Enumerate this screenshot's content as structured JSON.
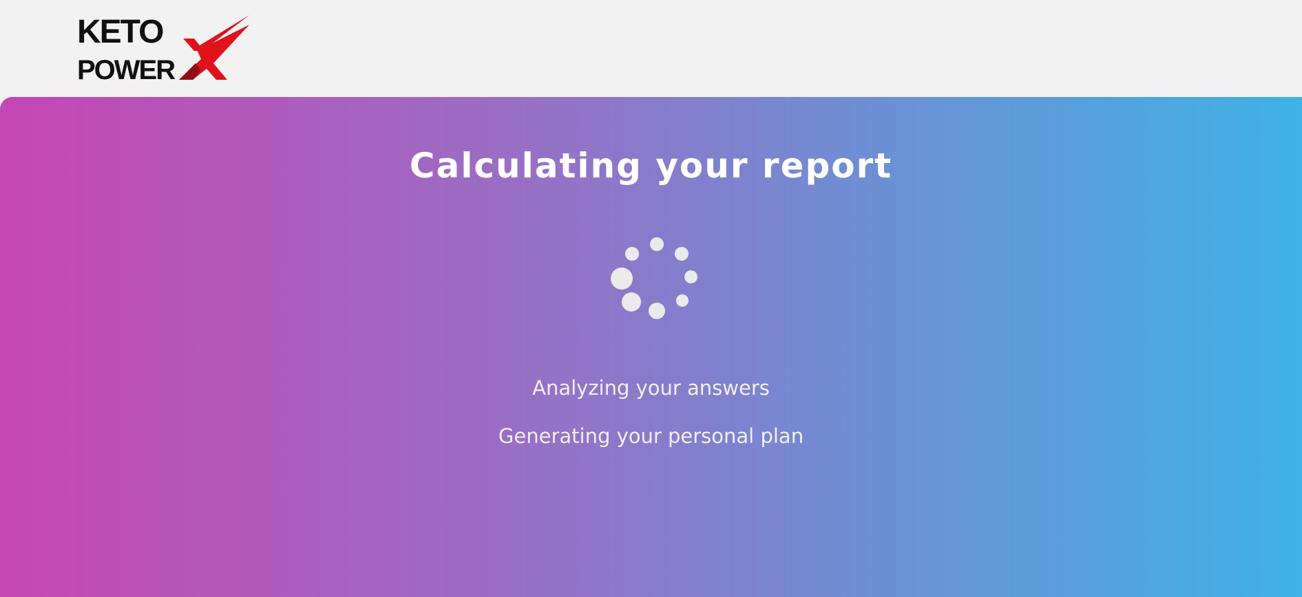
{
  "brand": {
    "logo_line1": "KETO",
    "logo_line2": "POWER",
    "logo_mark": "X",
    "colors": {
      "dark": "#111111",
      "accent": "#e0121c",
      "accent_dark": "#8f0d12"
    }
  },
  "main": {
    "title": "Calculating your report",
    "spinner_icon": "loading-dots-icon",
    "status_lines": [
      "Analyzing your answers",
      "Generating your personal plan"
    ],
    "gradient": {
      "start": "#c646b3",
      "end": "#3fb2e6"
    }
  }
}
